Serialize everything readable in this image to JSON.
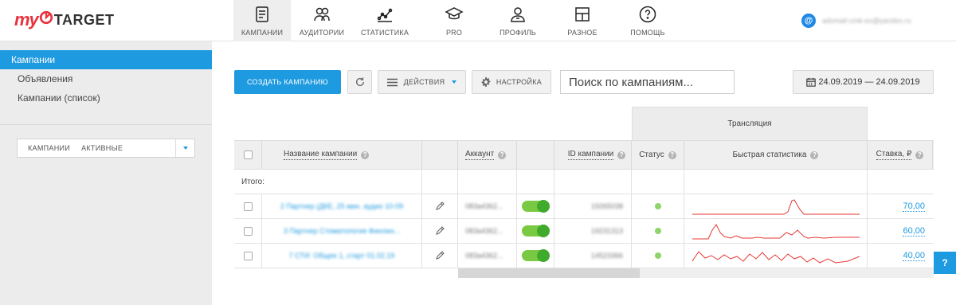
{
  "brand": {
    "my": "my",
    "target": "TARGET"
  },
  "nav": [
    {
      "label": "КАМПАНИИ",
      "icon": "campaigns-icon"
    },
    {
      "label": "АУДИТОРИИ",
      "icon": "audiences-icon"
    },
    {
      "label": "СТАТИСТИКА",
      "icon": "statistics-icon"
    },
    {
      "label": "PRO",
      "icon": "pro-icon"
    },
    {
      "label": "ПРОФИЛЬ",
      "icon": "profile-icon"
    },
    {
      "label": "РАЗНОЕ",
      "icon": "misc-icon"
    },
    {
      "label": "ПОМОЩЬ",
      "icon": "help-icon"
    }
  ],
  "account": {
    "avatar": "@",
    "email": "advmail-cmk-ex@yandex.ru"
  },
  "sidebar": {
    "items": [
      {
        "label": "Кампании"
      },
      {
        "label": "Объявления"
      },
      {
        "label": "Кампании (список)"
      }
    ],
    "filter": {
      "first": "КАМПАНИИ",
      "second": "АКТИВНЫЕ"
    }
  },
  "toolbar": {
    "create": "СОЗДАТЬ КАМПАНИЮ",
    "actions": "ДЕЙСТВИЯ",
    "settings": "НАСТРОЙКА",
    "search_placeholder": "Поиск по кампаниям...",
    "date_range": "24.09.2019 — 24.09.2019"
  },
  "table": {
    "group_header": "Трансляция",
    "headers": {
      "name": "Название кампании",
      "account": "Аккаунт",
      "id": "ID кампании",
      "status": "Статус",
      "quick": "Быстрая статистика",
      "rate": "Ставка, ₽"
    },
    "total_label": "Итого:",
    "rows": [
      {
        "name": "2 Партнер (ДКЕ, 25 мин. аудио 10-09",
        "account": "083a4362...",
        "id": "19265038",
        "rate": "70,00"
      },
      {
        "name": "3 Партнер Стоматология Финлин...",
        "account": "083a4362...",
        "id": "19231313",
        "rate": "60,00"
      },
      {
        "name": "7 СТИ: Общее 1, старт 01.02.19",
        "account": "083a4362...",
        "id": "14523366",
        "rate": "40,00"
      }
    ]
  },
  "help_fab": "?",
  "colors": {
    "accent": "#1e9ae0",
    "brand": "#e8323c",
    "toggle_on": "#7ac943",
    "spark": "#e53935"
  }
}
